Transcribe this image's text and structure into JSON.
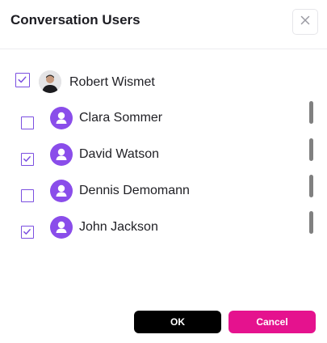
{
  "dialog": {
    "title": "Conversation Users",
    "close_icon": "close-icon"
  },
  "owner": {
    "name": "Robert Wismet",
    "checked": true,
    "avatar": "photo"
  },
  "users": [
    {
      "name": "Clara Sommer",
      "checked": false,
      "avatar_icon": "user-icon"
    },
    {
      "name": "David Watson",
      "checked": true,
      "avatar_icon": "user-icon"
    },
    {
      "name": "Dennis Demomann",
      "checked": false,
      "avatar_icon": "user-icon"
    },
    {
      "name": "John Jackson",
      "checked": true,
      "avatar_icon": "user-icon"
    }
  ],
  "actions": {
    "ok_label": "OK",
    "cancel_label": "Cancel"
  },
  "colors": {
    "accent": "#7b4fe0",
    "avatar": "#8a4dea",
    "ok_button": "#000000",
    "cancel_button": "#e5128e"
  }
}
